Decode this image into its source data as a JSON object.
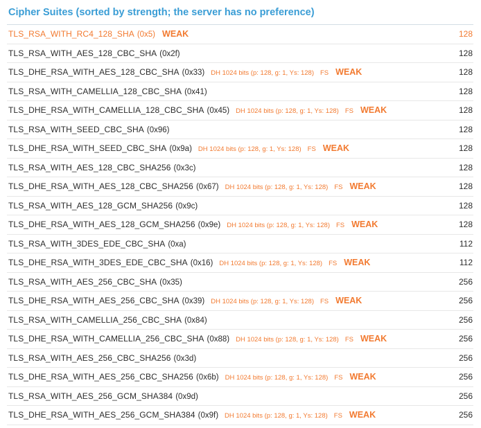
{
  "section": {
    "title": "Cipher Suites (sorted by strength; the server has no preference)"
  },
  "colors": {
    "title": "#3a9dd5",
    "warning": "#f27a30",
    "text": "#2b2b2b",
    "divider": "#e7e7e7"
  },
  "labels": {
    "weak": "WEAK",
    "fs": "FS"
  },
  "suites": [
    {
      "name": "TLS_RSA_WITH_RC4_128_SHA",
      "code": "(0x5)",
      "dh": "",
      "fs": false,
      "weak": true,
      "bits": "128",
      "insecure": true
    },
    {
      "name": "TLS_RSA_WITH_AES_128_CBC_SHA",
      "code": "(0x2f)",
      "dh": "",
      "fs": false,
      "weak": false,
      "bits": "128"
    },
    {
      "name": "TLS_DHE_RSA_WITH_AES_128_CBC_SHA",
      "code": "(0x33)",
      "dh": "DH 1024 bits (p: 128, g: 1, Ys: 128)",
      "fs": true,
      "weak": true,
      "bits": "128"
    },
    {
      "name": "TLS_RSA_WITH_CAMELLIA_128_CBC_SHA",
      "code": "(0x41)",
      "dh": "",
      "fs": false,
      "weak": false,
      "bits": "128"
    },
    {
      "name": "TLS_DHE_RSA_WITH_CAMELLIA_128_CBC_SHA",
      "code": "(0x45)",
      "dh": "DH 1024 bits (p: 128, g: 1, Ys: 128)",
      "fs": true,
      "weak": true,
      "bits": "128"
    },
    {
      "name": "TLS_RSA_WITH_SEED_CBC_SHA",
      "code": "(0x96)",
      "dh": "",
      "fs": false,
      "weak": false,
      "bits": "128"
    },
    {
      "name": "TLS_DHE_RSA_WITH_SEED_CBC_SHA",
      "code": "(0x9a)",
      "dh": "DH 1024 bits (p: 128, g: 1, Ys: 128)",
      "fs": true,
      "weak": true,
      "bits": "128"
    },
    {
      "name": "TLS_RSA_WITH_AES_128_CBC_SHA256",
      "code": "(0x3c)",
      "dh": "",
      "fs": false,
      "weak": false,
      "bits": "128"
    },
    {
      "name": "TLS_DHE_RSA_WITH_AES_128_CBC_SHA256",
      "code": "(0x67)",
      "dh": "DH 1024 bits (p: 128, g: 1, Ys: 128)",
      "fs": true,
      "weak": true,
      "bits": "128"
    },
    {
      "name": "TLS_RSA_WITH_AES_128_GCM_SHA256",
      "code": "(0x9c)",
      "dh": "",
      "fs": false,
      "weak": false,
      "bits": "128"
    },
    {
      "name": "TLS_DHE_RSA_WITH_AES_128_GCM_SHA256",
      "code": "(0x9e)",
      "dh": "DH 1024 bits (p: 128, g: 1, Ys: 128)",
      "fs": true,
      "weak": true,
      "bits": "128"
    },
    {
      "name": "TLS_RSA_WITH_3DES_EDE_CBC_SHA",
      "code": "(0xa)",
      "dh": "",
      "fs": false,
      "weak": false,
      "bits": "112"
    },
    {
      "name": "TLS_DHE_RSA_WITH_3DES_EDE_CBC_SHA",
      "code": "(0x16)",
      "dh": "DH 1024 bits (p: 128, g: 1, Ys: 128)",
      "fs": true,
      "weak": true,
      "bits": "112"
    },
    {
      "name": "TLS_RSA_WITH_AES_256_CBC_SHA",
      "code": "(0x35)",
      "dh": "",
      "fs": false,
      "weak": false,
      "bits": "256"
    },
    {
      "name": "TLS_DHE_RSA_WITH_AES_256_CBC_SHA",
      "code": "(0x39)",
      "dh": "DH 1024 bits (p: 128, g: 1, Ys: 128)",
      "fs": true,
      "weak": true,
      "bits": "256"
    },
    {
      "name": "TLS_RSA_WITH_CAMELLIA_256_CBC_SHA",
      "code": "(0x84)",
      "dh": "",
      "fs": false,
      "weak": false,
      "bits": "256"
    },
    {
      "name": "TLS_DHE_RSA_WITH_CAMELLIA_256_CBC_SHA",
      "code": "(0x88)",
      "dh": "DH 1024 bits (p: 128, g: 1, Ys: 128)",
      "fs": true,
      "weak": true,
      "bits": "256"
    },
    {
      "name": "TLS_RSA_WITH_AES_256_CBC_SHA256",
      "code": "(0x3d)",
      "dh": "",
      "fs": false,
      "weak": false,
      "bits": "256"
    },
    {
      "name": "TLS_DHE_RSA_WITH_AES_256_CBC_SHA256",
      "code": "(0x6b)",
      "dh": "DH 1024 bits (p: 128, g: 1, Ys: 128)",
      "fs": true,
      "weak": true,
      "bits": "256"
    },
    {
      "name": "TLS_RSA_WITH_AES_256_GCM_SHA384",
      "code": "(0x9d)",
      "dh": "",
      "fs": false,
      "weak": false,
      "bits": "256"
    },
    {
      "name": "TLS_DHE_RSA_WITH_AES_256_GCM_SHA384",
      "code": "(0x9f)",
      "dh": "DH 1024 bits (p: 128, g: 1, Ys: 128)",
      "fs": true,
      "weak": true,
      "bits": "256"
    }
  ]
}
